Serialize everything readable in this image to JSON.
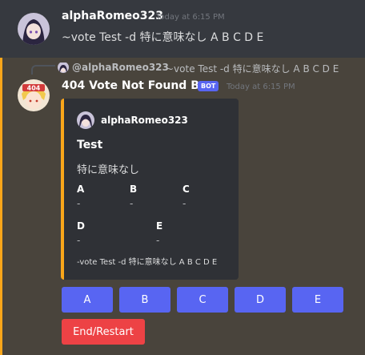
{
  "message1": {
    "username": "alphaRomeo323",
    "timestamp": "Today at 6:15 PM",
    "content": "~vote Test -d 特に意味なし A B C D E"
  },
  "reply": {
    "username": "@alphaRomeo323",
    "content": "~vote Test -d 特に意味なし A B C D E"
  },
  "message2": {
    "username": "404 Vote Not Found Bot",
    "badge": "BOT",
    "timestamp": "Today at 6:15 PM",
    "accent_color": "#faa61a"
  },
  "embed": {
    "author": "alphaRomeo323",
    "title": "Test",
    "description": "特に意味なし",
    "fields": [
      {
        "name": "A",
        "value": "-"
      },
      {
        "name": "B",
        "value": "-"
      },
      {
        "name": "C",
        "value": "-"
      },
      {
        "name": "D",
        "value": "-"
      },
      {
        "name": "E",
        "value": "-"
      }
    ],
    "footer": "-vote Test -d 特に意味なし A B C D E"
  },
  "buttons": {
    "votes": [
      "A",
      "B",
      "C",
      "D",
      "E"
    ],
    "end_restart": "End/Restart",
    "primary_color": "#5865f2",
    "danger_color": "#ed4245"
  }
}
